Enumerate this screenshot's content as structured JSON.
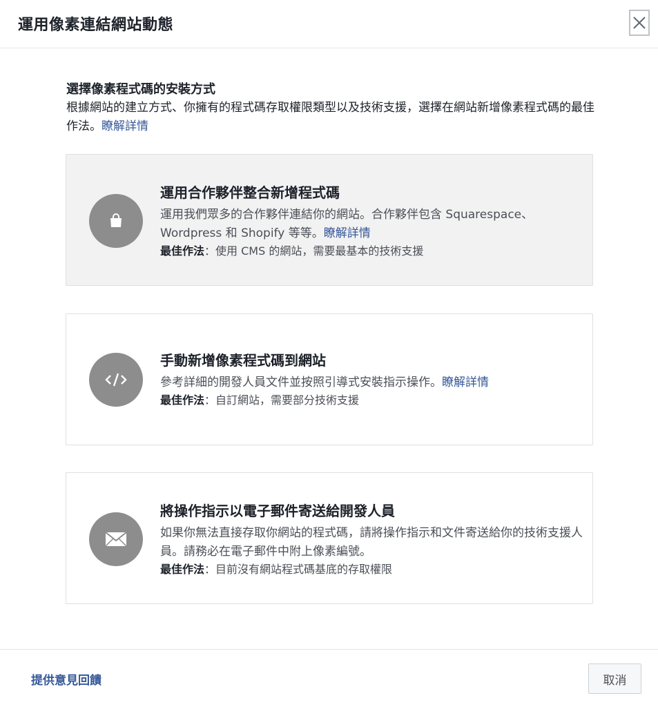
{
  "header": {
    "title": "運用像素連結網站動態",
    "close_icon": "close-icon"
  },
  "intro": {
    "title": "選擇像素程式碼的安裝方式",
    "body": "根據網站的建立方式、你擁有的程式碼存取權限類型以及技術支援，選擇在網站新增像素程式碼的最佳作法。",
    "link": "瞭解詳情"
  },
  "options": [
    {
      "icon": "shopping-bag-icon",
      "title": "運用合作夥伴整合新增程式碼",
      "desc": "運用我們眾多的合作夥伴連結你的網站。合作夥伴包含 Squarespace、Wordpress 和 Shopify 等等。",
      "link": "瞭解詳情",
      "best_label": "最佳作法",
      "best_text": "：使用 CMS 的網站，需要最基本的技術支援"
    },
    {
      "icon": "code-icon",
      "title": "手動新增像素程式碼到網站",
      "desc": "參考詳細的開發人員文件並按照引導式安裝指示操作。",
      "link": "瞭解詳情",
      "best_label": "最佳作法",
      "best_text": "：自訂網站，需要部分技術支援"
    },
    {
      "icon": "envelope-icon",
      "title": "將操作指示以電子郵件寄送給開發人員",
      "desc": "如果你無法直接存取你網站的程式碼，請將操作指示和文件寄送給你的技術支援人員。請務必在電子郵件中附上像素編號。",
      "link": "",
      "best_label": "最佳作法",
      "best_text": "：目前沒有網站程式碼基底的存取權限"
    }
  ],
  "footer": {
    "feedback": "提供意見回饋",
    "cancel": "取消"
  },
  "colors": {
    "link": "#365899",
    "icon_circle": "#8d8d8d",
    "selected_card": "#f2f2f2"
  }
}
